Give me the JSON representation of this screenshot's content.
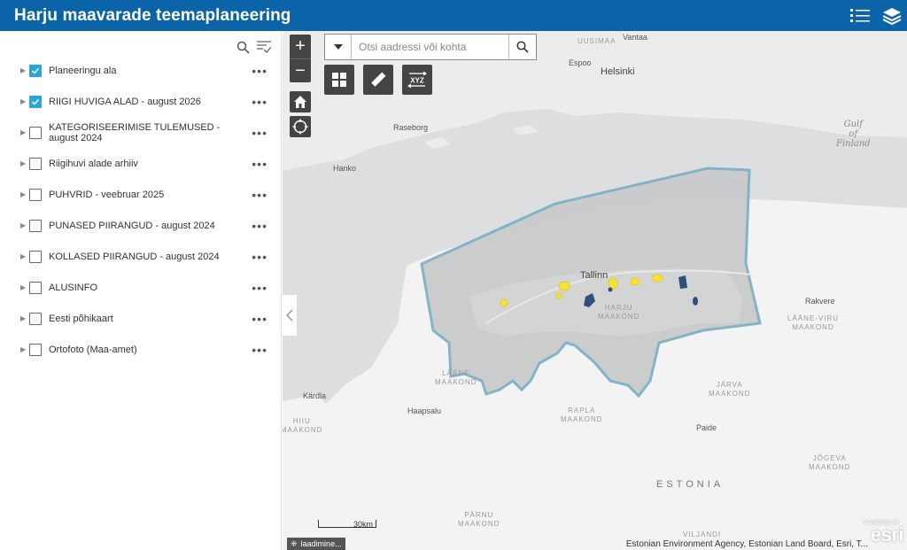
{
  "app": {
    "title": "Harju maavarade teemaplaneering"
  },
  "header": {
    "icons": [
      "legend-list-icon",
      "layers-icon"
    ]
  },
  "panel": {
    "tools": [
      "search-icon",
      "filter-icon"
    ],
    "layers": [
      {
        "label": "Planeeringu ala",
        "checked": true
      },
      {
        "label": "RIIGI HUVIGA ALAD - august 2026",
        "checked": true
      },
      {
        "label": "KATEGORISEERIMISE TULEMUSED - august 2024",
        "checked": false
      },
      {
        "label": "Riigihuvi alade arhiiv",
        "checked": false
      },
      {
        "label": "PUHVRID - veebruar 2025",
        "checked": false
      },
      {
        "label": "PUNASED PIIRANGUD - august 2024",
        "checked": false
      },
      {
        "label": "KOLLASED PIIRANGUD - august 2024",
        "checked": false
      },
      {
        "label": "ALUSINFO",
        "checked": false
      },
      {
        "label": "Eesti põhikaart",
        "checked": false
      },
      {
        "label": "Ortofoto (Maa-amet)",
        "checked": false
      }
    ],
    "more_label": "•••"
  },
  "map": {
    "zoom_in": "+",
    "zoom_out": "−",
    "search": {
      "placeholder": "Otsi aadressi või kohta",
      "value": ""
    },
    "tools": [
      "basemap-gallery-icon",
      "measure-icon",
      "coordinate-icon"
    ],
    "coordinate_label": "XYZ",
    "labels": {
      "uusimaa": "UUSIMAA",
      "vantaa": "Vantaa",
      "espoo": "Espoo",
      "helsinki": "Helsinki",
      "raseborg": "Raseborg",
      "hanko": "Hanko",
      "gulf": "Gulf\nof\nFinland",
      "tallinn": "Tallinn",
      "harju": "HARJU\nMAAKOND",
      "rakvere": "Rakvere",
      "laane_viru": "LÄÄNE-VIRU\nMAAKOND",
      "laane": "LÄÄNE\nMAAKOND",
      "jarva": "JÄRVA\nMAAKOND",
      "kardla": "Kärdla",
      "hiiu": "HIIU\nMAAKOND",
      "haapsalu": "Haapsalu",
      "rapla": "RAPLA\nMAAKOND",
      "paide": "Paide",
      "jogeva": "JÕGEVA\nMAAKOND",
      "estonia": "ESTONIA",
      "parnu": "PÄRNU\nMAAKOND",
      "viljandi": "VILJANDI"
    },
    "scale": "30km",
    "status": "laadimine...",
    "attribution": "Estonian Environment Agency, Estonian Land Board, Esri, T...",
    "esri_logo": "esri",
    "esri_powered": "POWERED BY",
    "colors": {
      "boundary": "#7fb0c6",
      "boundary_fill": "#c9cbcb",
      "yellow": "#f6e33a",
      "dark_blue": "#2e4f7c"
    }
  }
}
